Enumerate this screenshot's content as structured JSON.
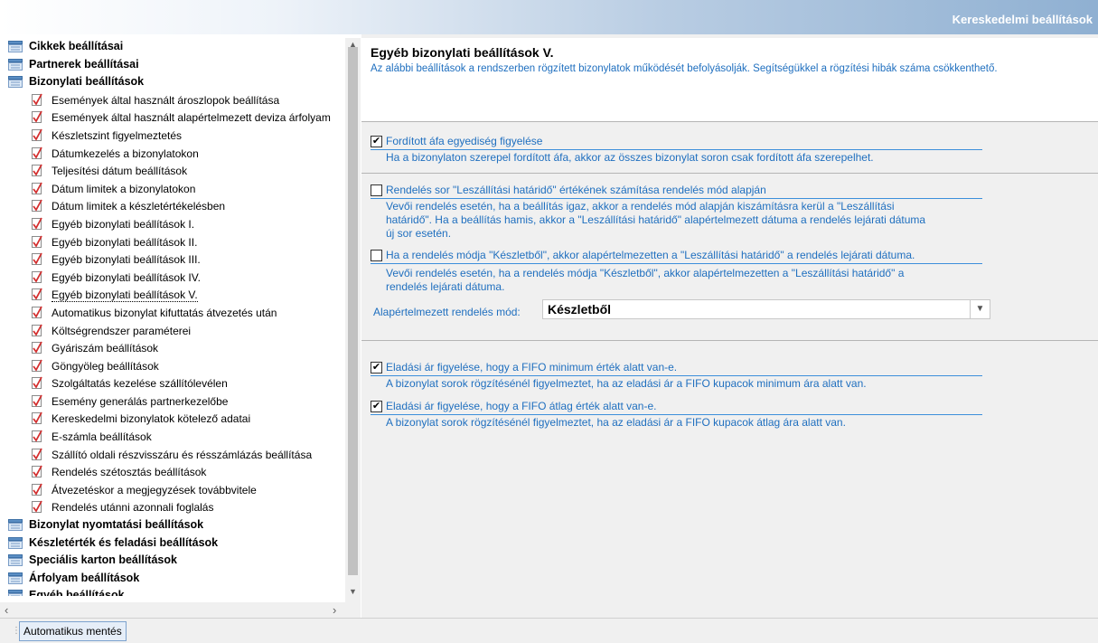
{
  "window": {
    "title": "Kereskedelmi beállítások"
  },
  "tree": {
    "groups_top": [
      {
        "label": "Cikkek beállításai",
        "icon": "folder-group-icon"
      },
      {
        "label": "Partnerek beállításai",
        "icon": "folder-group-icon"
      },
      {
        "label": "Bizonylati beállítások",
        "icon": "folder-group-icon",
        "expanded": true
      }
    ],
    "children": [
      {
        "label": "Események által használt ároszlopok beállítása"
      },
      {
        "label": "Események által használt alapértelmezett deviza árfolyam"
      },
      {
        "label": "Készletszint figyelmeztetés"
      },
      {
        "label": "Dátumkezelés a bizonylatokon"
      },
      {
        "label": "Teljesítési dátum beállítások"
      },
      {
        "label": "Dátum limitek a bizonylatokon"
      },
      {
        "label": "Dátum limitek a készletértékelésben"
      },
      {
        "label": "Egyéb bizonylati beállítások I."
      },
      {
        "label": "Egyéb bizonylati beállítások II."
      },
      {
        "label": "Egyéb bizonylati beállítások III."
      },
      {
        "label": "Egyéb bizonylati beállítások IV."
      },
      {
        "label": "Egyéb bizonylati beállítások V.",
        "selected": true
      },
      {
        "label": "Automatikus bizonylat kifuttatás átvezetés után"
      },
      {
        "label": "Költségrendszer paraméterei"
      },
      {
        "label": "Gyáriszám beállítások"
      },
      {
        "label": "Göngyöleg beállítások"
      },
      {
        "label": "Szolgáltatás kezelése szállítólevélen"
      },
      {
        "label": "Esemény generálás partnerkezelőbe"
      },
      {
        "label": "Kereskedelmi bizonylatok kötelező adatai"
      },
      {
        "label": "E-számla beállítások"
      },
      {
        "label": "Szállító oldali részvisszáru és résszámlázás beállítása"
      },
      {
        "label": "Rendelés szétosztás beállítások"
      },
      {
        "label": "Átvezetéskor a megjegyzések továbbvitele"
      },
      {
        "label": "Rendelés utánni azonnali foglalás"
      }
    ],
    "groups_bottom": [
      {
        "label": "Bizonylat nyomtatási beállítások"
      },
      {
        "label": "Készletérték és feladási beállítások"
      },
      {
        "label": "Speciális karton beállítások"
      },
      {
        "label": "Árfolyam beállítások"
      },
      {
        "label": "Egyéb beállítások"
      }
    ]
  },
  "panel": {
    "title": "Egyéb bizonylati beállítások V.",
    "description": "Az alábbi beállítások a rendszerben rögzített bizonylatok működését befolyásolják. Segítségükkel a rögzítési hibák száma csökkenthető.",
    "options": [
      {
        "label": "Fordított áfa egyediség figyelése",
        "checked": true,
        "description": [
          "Ha a bizonylaton szerepel fordított áfa, akkor az összes bizonylat soron csak fordított áfa szerepelhet."
        ]
      },
      {
        "label": "Rendelés sor \"Leszállítási határidő\" értékének számítása rendelés mód alapján",
        "checked": false,
        "description": [
          "Vevői rendelés esetén, ha a beállítás igaz, akkor a rendelés mód alapján kiszámításra kerül a \"Leszállítási",
          "határidő\". Ha a beállítás hamis, akkor a \"Leszállítási határidő\" alapértelmezett dátuma a rendelés lejárati dátuma",
          "új sor esetén."
        ]
      },
      {
        "label": "Ha a rendelés módja \"Készletből\", akkor alapértelmezetten a \"Leszállítási határidő\" a rendelés lejárati dátuma.",
        "checked": false,
        "description": [
          "Vevői rendelés esetén, ha a rendelés módja \"Készletből\", akkor alapértelmezetten a \"Leszállítási határidő\" a",
          "rendelés lejárati dátuma."
        ]
      },
      {
        "label": "Eladási ár figyelése, hogy a FIFO minimum érték alatt van-e.",
        "checked": true,
        "description": [
          "A bizonylat sorok rögzítésénél figyelmeztet, ha az eladási ár a FIFO kupacok minimum ára alatt van."
        ]
      },
      {
        "label": "Eladási ár figyelése, hogy a FIFO átlag érték alatt van-e.",
        "checked": true,
        "description": [
          "A bizonylat sorok rögzítésénél figyelmeztet, ha az eladási ár a FIFO kupacok átlag ára alatt van."
        ]
      }
    ],
    "order_mode": {
      "label": "Alapértelmezett rendelés mód:",
      "value": "Készletből"
    }
  },
  "statusbar": {
    "autosave_label": "Automatikus mentés"
  },
  "colors": {
    "accent_text": "#1f6fbf",
    "title_bar_end": "#8fb0d2",
    "error_icon": "#d32f2f"
  }
}
